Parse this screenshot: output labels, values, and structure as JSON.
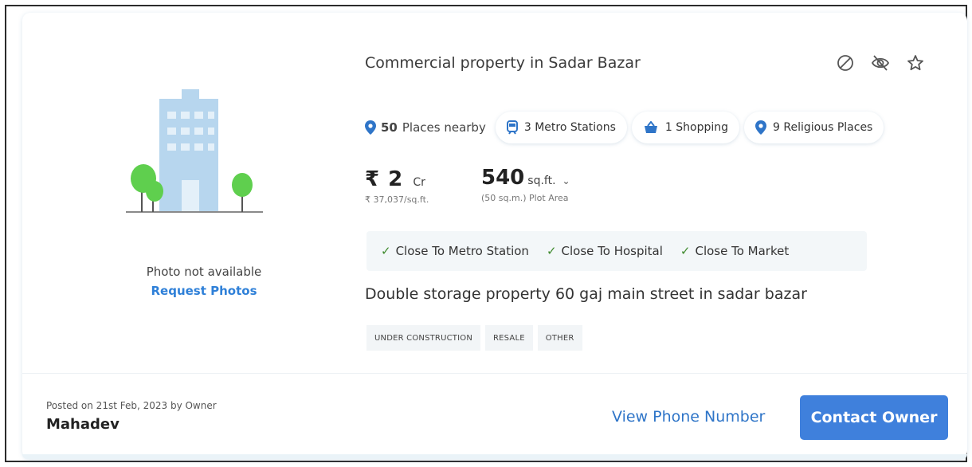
{
  "listing": {
    "title": "Commercial property in Sadar Bazar",
    "photo_text": "Photo not available",
    "request_photos": "Request Photos",
    "places": {
      "count": "50",
      "label": "Places nearby",
      "chips": [
        {
          "label": "3 Metro Stations",
          "icon": "metro-icon"
        },
        {
          "label": "1 Shopping",
          "icon": "shopping-icon"
        },
        {
          "label": "9 Religious Places",
          "icon": "location-pin-icon"
        }
      ]
    },
    "price": {
      "symbol": "₹",
      "value": "2",
      "unit": "Cr",
      "per_sqft": "₹ 37,037/sq.ft."
    },
    "area": {
      "value": "540",
      "unit": "sq.ft.",
      "caret": "⌄",
      "sub": "(50 sq.m.) Plot Area"
    },
    "features": [
      "Close To Metro Station",
      "Close To Hospital",
      "Close To Market"
    ],
    "check_glyph": "✓",
    "description": "Double storage property 60 gaj main street in sadar bazar",
    "tags": [
      "UNDER CONSTRUCTION",
      "RESALE",
      "OTHER"
    ]
  },
  "footer": {
    "posted": "Posted on 21st Feb, 2023 by Owner",
    "owner_name": "Mahadev",
    "view_phone": "View Phone Number",
    "contact": "Contact Owner"
  },
  "colors": {
    "accent": "#3f80dc",
    "link": "#2f75c8",
    "check": "#3f8a2e",
    "building": "#b7d6ee",
    "tree": "#5fcf4e"
  },
  "icons": [
    "block-icon",
    "hide-icon",
    "star-icon"
  ]
}
